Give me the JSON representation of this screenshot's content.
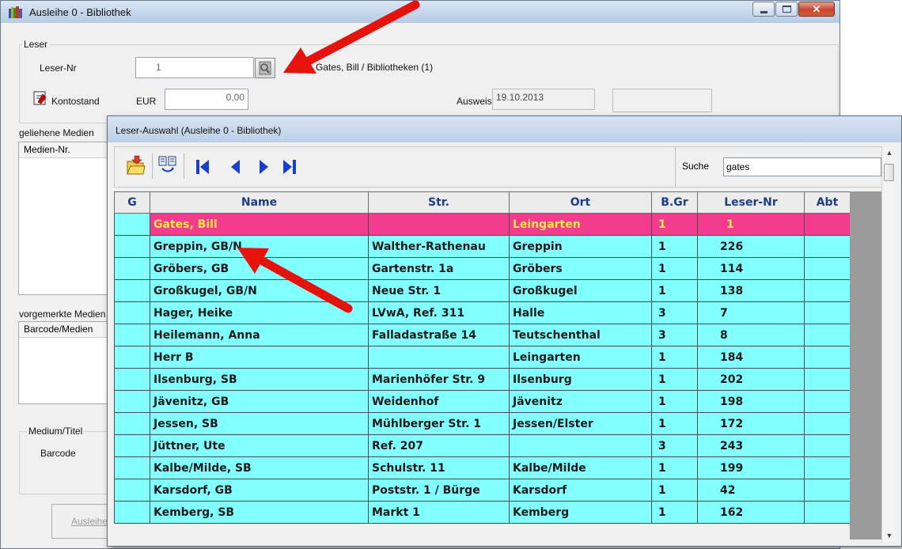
{
  "main_window": {
    "title": "Ausleihe 0 - Bibliothek",
    "leser_group": {
      "legend": "Leser",
      "leser_nr_label": "Leser-Nr",
      "leser_nr_value": "1",
      "reader_name": "Gates, Bill / Bibliotheken (1)",
      "kontostand_label": "Kontostand",
      "currency_label": "EUR",
      "balance_value": "0,00",
      "ausweis_label": "Ausweis",
      "ausweis_value": "19.10.2013",
      "extra_value": ""
    },
    "geliehene_label": "geliehene Medien",
    "medien_nr_header": "Medien-Nr.",
    "vorgemerkte_label": "vorgemerkte Medien",
    "barcode_medien_header": "Barcode/Medien",
    "medium_group_legend": "Medium/Titel",
    "barcode_label": "Barcode",
    "ausleihe_button": "Ausleihe"
  },
  "dialog": {
    "title": "Leser-Auswahl  (Ausleihe 0 - Bibliothek)",
    "search_label": "Suche",
    "search_value": "gates",
    "columns": [
      "G",
      "Name",
      "Str.",
      "Ort",
      "B.Gr",
      "Leser-Nr",
      "Abt"
    ],
    "rows": [
      [
        "",
        "Gates, Bill",
        "",
        "Leingarten",
        "1",
        "1",
        ""
      ],
      [
        "",
        "Greppin, GB/N",
        "Walther-Rathenau",
        "Greppin",
        "1",
        "226",
        ""
      ],
      [
        "",
        "Gröbers, GB",
        "Gartenstr. 1a",
        "Gröbers",
        "1",
        "114",
        ""
      ],
      [
        "",
        "Großkugel, GB/N",
        "Neue Str. 1",
        "Großkugel",
        "1",
        "138",
        ""
      ],
      [
        "",
        "Hager, Heike",
        "LVwA, Ref. 311",
        "Halle",
        "3",
        "7",
        ""
      ],
      [
        "",
        "Heilemann, Anna",
        "Falladastraße 14",
        "Teutschenthal",
        "3",
        "8",
        ""
      ],
      [
        "",
        "Herr B",
        "",
        "Leingarten",
        "1",
        "184",
        ""
      ],
      [
        "",
        "Ilsenburg, SB",
        "Marienhöfer Str. 9",
        "Ilsenburg",
        "1",
        "202",
        ""
      ],
      [
        "",
        "Jävenitz, GB",
        "Weidenhof",
        "Jävenitz",
        "1",
        "198",
        ""
      ],
      [
        "",
        "Jessen, SB",
        "Mühlberger Str. 1",
        "Jessen/Elster",
        "1",
        "172",
        ""
      ],
      [
        "",
        "Jüttner, Ute",
        "Ref. 207",
        "",
        "3",
        "243",
        ""
      ],
      [
        "",
        "Kalbe/Milde, SB",
        "Schulstr. 11",
        "Kalbe/Milde",
        "1",
        "199",
        ""
      ],
      [
        "",
        "Karsdorf, GB",
        "Poststr. 1 / Bürge",
        "Karsdorf",
        "1",
        "42",
        ""
      ],
      [
        "",
        "Kemberg, SB",
        "Markt 1",
        "Kemberg",
        "1",
        "162",
        ""
      ]
    ],
    "selected_row": 0
  },
  "colors": {
    "row_background": "#82ffff",
    "selected_row_background": "#f33b8d",
    "selected_row_text": "#ffe84a",
    "annotation_arrow": "#e8120c",
    "nav_arrow": "#1a3fd0"
  },
  "icons": {
    "app": "library-books-icon",
    "lookup": "reader-search-icon",
    "kontostand": "account-sheet-icon",
    "toolbar": [
      "open-folder-icon",
      "refresh-list-icon",
      "first-record-icon",
      "previous-record-icon",
      "next-record-icon",
      "last-record-icon"
    ]
  }
}
